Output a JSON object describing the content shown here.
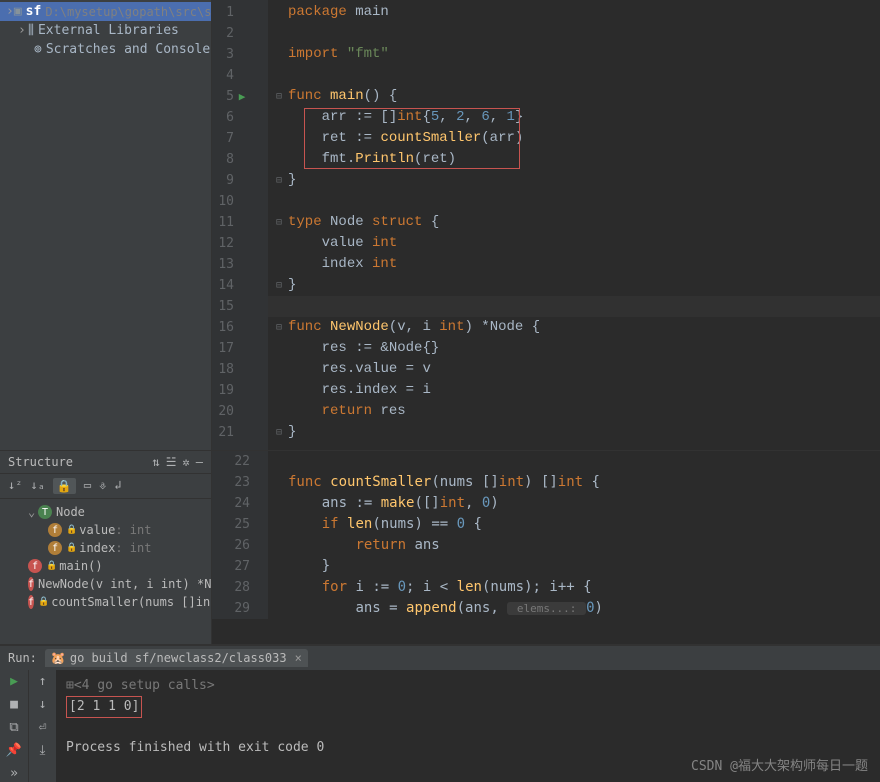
{
  "project": {
    "root_name": "sf",
    "root_path": "D:\\mysetup\\gopath\\src\\sf",
    "external_libs": "External Libraries",
    "scratches": "Scratches and Consoles"
  },
  "editor": {
    "lines": [
      {
        "n": "1",
        "fold": "",
        "run": "",
        "html": "<span class='kw'>package</span> <span class='ident'>main</span>"
      },
      {
        "n": "2",
        "fold": "",
        "run": "",
        "html": ""
      },
      {
        "n": "3",
        "fold": "",
        "run": "",
        "html": "<span class='kw'>import</span> <span class='str'>\"fmt\"</span>"
      },
      {
        "n": "4",
        "fold": "",
        "run": "",
        "html": ""
      },
      {
        "n": "5",
        "fold": "⊟",
        "run": "▶",
        "html": "<span class='kw'>func</span> <span class='fn'>main</span>() {"
      },
      {
        "n": "6",
        "fold": "",
        "run": "",
        "html": "    <span class='ident'>arr</span> := []<span class='typ'>int</span>{<span class='num'>5</span>, <span class='num'>2</span>, <span class='num'>6</span>, <span class='num'>1</span>}",
        "boxstart": true
      },
      {
        "n": "7",
        "fold": "",
        "run": "",
        "html": "    <span class='ident'>ret</span> := <span class='fn'>countSmaller</span>(<span class='ident'>arr</span>)"
      },
      {
        "n": "8",
        "fold": "",
        "run": "",
        "html": "    <span class='ident'>fmt</span>.<span class='fn'>Println</span>(<span class='ident'>ret</span>)",
        "boxend": true
      },
      {
        "n": "9",
        "fold": "⊟",
        "run": "",
        "html": "}"
      },
      {
        "n": "10",
        "fold": "",
        "run": "",
        "html": ""
      },
      {
        "n": "11",
        "fold": "⊟",
        "run": "",
        "html": "<span class='kw'>type</span> <span class='ident'>Node</span> <span class='kw'>struct</span> {"
      },
      {
        "n": "12",
        "fold": "",
        "run": "",
        "html": "    <span class='ident'>value</span> <span class='typ'>int</span>"
      },
      {
        "n": "13",
        "fold": "",
        "run": "",
        "html": "    <span class='ident'>index</span> <span class='typ'>int</span>"
      },
      {
        "n": "14",
        "fold": "⊟",
        "run": "",
        "html": "}"
      },
      {
        "n": "15",
        "fold": "",
        "run": "",
        "html": "",
        "caret": true
      },
      {
        "n": "16",
        "fold": "⊟",
        "run": "",
        "html": "<span class='kw'>func</span> <span class='fn'>NewNode</span>(<span class='ident'>v</span>, <span class='ident'>i</span> <span class='typ'>int</span>) *<span class='ident'>Node</span> {"
      },
      {
        "n": "17",
        "fold": "",
        "run": "",
        "html": "    <span class='ident'>res</span> := &<span class='ident'>Node</span>{}"
      },
      {
        "n": "18",
        "fold": "",
        "run": "",
        "html": "    <span class='ident'>res</span>.<span class='ident'>value</span> = <span class='ident'>v</span>"
      },
      {
        "n": "19",
        "fold": "",
        "run": "",
        "html": "    <span class='ident'>res</span>.<span class='ident'>index</span> = <span class='ident'>i</span>"
      },
      {
        "n": "20",
        "fold": "",
        "run": "",
        "html": "    <span class='kw'>return</span> <span class='ident'>res</span>"
      },
      {
        "n": "21",
        "fold": "⊟",
        "run": "",
        "html": "}"
      }
    ]
  },
  "structure": {
    "title": "Structure",
    "items": [
      {
        "kind": "type",
        "name": "Node",
        "type": "",
        "ind": 0,
        "chev": "⌄"
      },
      {
        "kind": "field",
        "name": "value",
        "type": ": int",
        "ind": 1,
        "lock": true
      },
      {
        "kind": "field",
        "name": "index",
        "type": ": int",
        "ind": 1,
        "lock": true
      },
      {
        "kind": "func",
        "name": "main()",
        "type": "",
        "ind": 0,
        "lock": true
      },
      {
        "kind": "func",
        "name": "NewNode(v int, i int) *Nod",
        "type": "",
        "ind": 0
      },
      {
        "kind": "func",
        "name": "countSmaller(nums []int) []i",
        "type": "",
        "ind": 0,
        "lock": true
      }
    ],
    "code_lines": [
      {
        "n": "22",
        "html": ""
      },
      {
        "n": "23",
        "html": "<span class='kw'>func</span> <span class='fn'>countSmaller</span>(<span class='ident'>nums</span> []<span class='typ'>int</span>) []<span class='typ'>int</span> {"
      },
      {
        "n": "24",
        "html": "    <span class='ident'>ans</span> := <span class='fn'>make</span>([]<span class='typ'>int</span>, <span class='num'>0</span>)"
      },
      {
        "n": "25",
        "html": "    <span class='kw'>if</span> <span class='fn'>len</span>(<span class='ident'>nums</span>) == <span class='num'>0</span> {"
      },
      {
        "n": "26",
        "html": "        <span class='kw'>return</span> <span class='ident'>ans</span>"
      },
      {
        "n": "27",
        "html": "    }"
      },
      {
        "n": "28",
        "html": "    <span class='kw'>for</span> <span class='ident'>i</span> := <span class='num'>0</span>; <span class='ident'>i</span> &lt; <span class='fn'>len</span>(<span class='ident'>nums</span>); <span class='ident'>i</span>++ {"
      },
      {
        "n": "29",
        "html": "        <span class='ident'>ans</span> = <span class='fn'>append</span>(<span class='ident'>ans</span>, <span class='paramhint'> elems...: </span><span class='num'>0</span>)"
      }
    ]
  },
  "run": {
    "label": "Run:",
    "tab": "go build sf/newclass2/class033",
    "setup_calls": "<4 go setup calls>",
    "output": "[2 1 1 0]",
    "exit": "Process finished with exit code 0"
  },
  "watermark": "CSDN @福大大架构师每日一题"
}
